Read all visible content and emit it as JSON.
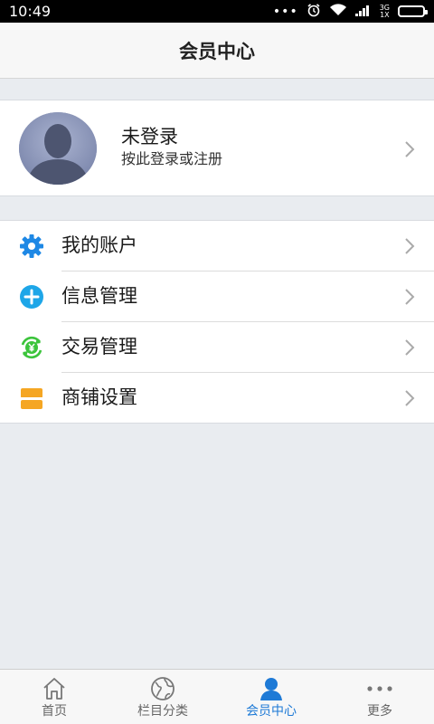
{
  "status_bar": {
    "time": "10:49",
    "dots": "•••",
    "network": [
      "3G",
      "1X"
    ]
  },
  "header": {
    "title": "会员中心"
  },
  "profile": {
    "name": "未登录",
    "subtitle": "按此登录或注册"
  },
  "menu": {
    "items": [
      {
        "label": "我的账户",
        "icon": "gear-icon",
        "color": "#1e88e5"
      },
      {
        "label": "信息管理",
        "icon": "plus-circle-icon",
        "color": "#1ea6e8"
      },
      {
        "label": "交易管理",
        "icon": "yen-exchange-icon",
        "color": "#3cc43c"
      },
      {
        "label": "商铺设置",
        "icon": "shop-icon",
        "color": "#f5a623"
      }
    ]
  },
  "tabs": [
    {
      "label": "首页",
      "icon": "home-icon",
      "active": false
    },
    {
      "label": "栏目分类",
      "icon": "globe-icon",
      "active": false
    },
    {
      "label": "会员中心",
      "icon": "user-icon",
      "active": true
    },
    {
      "label": "更多",
      "icon": "more-icon",
      "active": false
    }
  ],
  "colors": {
    "accent": "#1e7ad6",
    "background": "#e9ecf0",
    "header_bg": "#f7f7f7"
  }
}
